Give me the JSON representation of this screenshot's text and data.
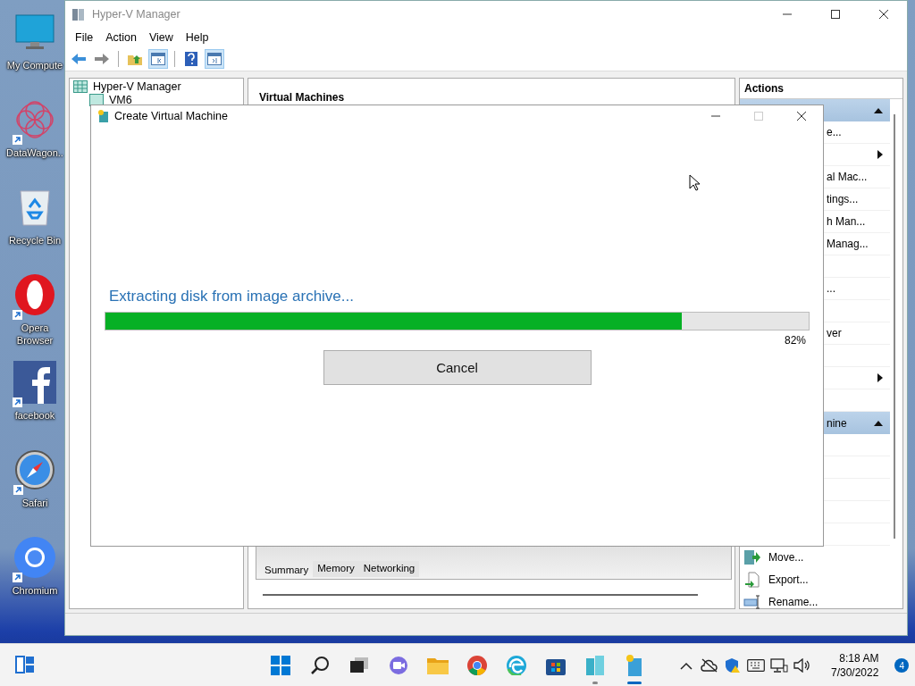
{
  "desktop_icons": [
    {
      "label": "My Compute",
      "kind": "monitor",
      "shortcut": false
    },
    {
      "label": "DataWagon..",
      "kind": "flower",
      "shortcut": true
    },
    {
      "label": "Recycle Bin",
      "kind": "bin",
      "shortcut": false
    },
    {
      "label": "Opera Browser",
      "kind": "opera",
      "shortcut": true
    },
    {
      "label": "facebook",
      "kind": "facebook",
      "shortcut": true
    },
    {
      "label": "Safari",
      "kind": "compass",
      "shortcut": true
    },
    {
      "label": "Chromium",
      "kind": "chromium",
      "shortcut": true
    }
  ],
  "manager_window": {
    "title": "Hyper-V Manager",
    "menu": [
      "File",
      "Action",
      "View",
      "Help"
    ],
    "toolbar": [
      {
        "kind": "back",
        "pressed": false
      },
      {
        "kind": "forward",
        "pressed": false
      },
      {
        "kind": "sep"
      },
      {
        "kind": "up",
        "pressed": false
      },
      {
        "kind": "tree",
        "pressed": true
      },
      {
        "kind": "sep"
      },
      {
        "kind": "help",
        "pressed": false
      },
      {
        "kind": "pane",
        "pressed": true
      }
    ],
    "tree": [
      {
        "label": "Hyper-V Manager",
        "children": [
          {
            "label": "VM6"
          }
        ]
      }
    ],
    "center": {
      "header": "Virtual Machines",
      "tabs": [
        {
          "label": "Summary",
          "selected": true
        },
        {
          "label": "Memory",
          "selected": false
        },
        {
          "label": "Networking",
          "selected": false
        }
      ]
    },
    "actions": {
      "title": "Actions",
      "items": [
        {
          "kind": "header"
        },
        {
          "kind": "partial",
          "label": "e..."
        },
        {
          "kind": "submenu"
        },
        {
          "kind": "partial",
          "label": "al Mac..."
        },
        {
          "kind": "partial",
          "label": "tings..."
        },
        {
          "kind": "partial",
          "label": "h Man..."
        },
        {
          "kind": "partial",
          "label": "Manag..."
        },
        {
          "kind": "blank"
        },
        {
          "kind": "partial",
          "label": "..."
        },
        {
          "kind": "blank"
        },
        {
          "kind": "partial",
          "label": "ver"
        },
        {
          "kind": "blank"
        },
        {
          "kind": "submenu"
        },
        {
          "kind": "blank"
        },
        {
          "kind": "header",
          "label": "nine"
        },
        {
          "kind": "blank"
        },
        {
          "kind": "blank"
        },
        {
          "kind": "blank"
        },
        {
          "kind": "blank"
        },
        {
          "kind": "blank"
        },
        {
          "kind": "move",
          "label": "Move..."
        },
        {
          "kind": "export",
          "label": "Export..."
        },
        {
          "kind": "rename",
          "label": "Rename..."
        }
      ]
    }
  },
  "dialog": {
    "title": "Create Virtual Machine",
    "message": "Extracting disk from image archive...",
    "progress": {
      "level": 0.82,
      "reading": "82%"
    },
    "button": "Cancel"
  },
  "taskbar": {
    "apps": [
      {
        "kind": "start",
        "running": false,
        "focused": false
      },
      {
        "kind": "search",
        "running": false,
        "focused": false
      },
      {
        "kind": "taskview",
        "running": false,
        "focused": false
      },
      {
        "kind": "chat",
        "running": false,
        "focused": false
      },
      {
        "kind": "folder",
        "running": false,
        "focused": false
      },
      {
        "kind": "chrome",
        "running": false,
        "focused": false
      },
      {
        "kind": "edge",
        "running": false,
        "focused": false
      },
      {
        "kind": "store",
        "running": false,
        "focused": false
      },
      {
        "kind": "servers",
        "running": true,
        "focused": false
      },
      {
        "kind": "server-star",
        "running": true,
        "focused": true
      }
    ],
    "tray": [
      {
        "kind": "chevron"
      },
      {
        "kind": "cloud"
      },
      {
        "kind": "shield"
      },
      {
        "kind": "keyboard"
      },
      {
        "kind": "network"
      },
      {
        "kind": "volume"
      }
    ],
    "time": "8:18 AM",
    "date": "7/30/2022",
    "notifications": "4"
  }
}
